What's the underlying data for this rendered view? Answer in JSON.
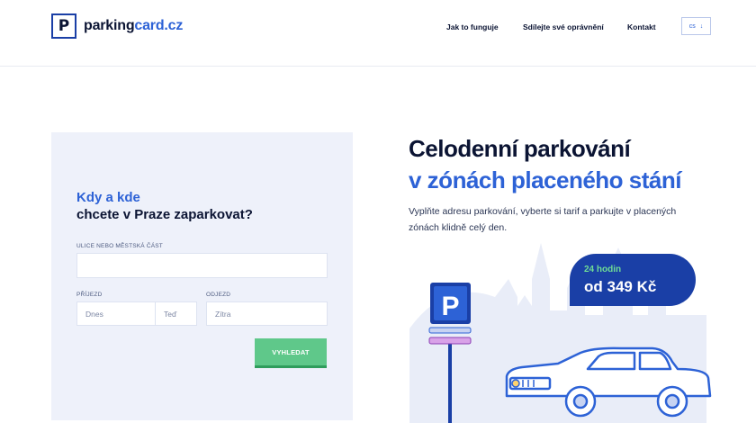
{
  "header": {
    "logo": {
      "letter": "P",
      "text_part1": "parking",
      "text_part2": "card.cz"
    },
    "nav": [
      "Jak to funguje",
      "Sdílejte své oprávnění",
      "Kontakt"
    ],
    "language": {
      "value": "cs",
      "arrow": "↓"
    }
  },
  "form": {
    "title_line1": "Kdy a kde",
    "title_line2": "chcete v Praze zaparkovat?",
    "street_label": "ULICE NEBO MĚSTSKÁ ČÁST",
    "street_value": "",
    "arrival_label": "PŘÍJEZD",
    "arrival_date": "Dnes",
    "arrival_time": "Teď",
    "departure_label": "ODJEZD",
    "departure_date": "Zítra",
    "search_button": "VYHLEDAT"
  },
  "hero": {
    "title_line1": "Celodenní parkování",
    "title_line2": "v zónách placeného stání",
    "description": "Vyplňte adresu parkování, vyberte si tarif a parkujte v placených zónách klidně celý den."
  },
  "badge": {
    "line1": "24 hodin",
    "line2": "od 349 Kč"
  },
  "sign": {
    "letter": "P"
  },
  "colors": {
    "brand_blue": "#1a3fa6",
    "accent_blue": "#2d62d6",
    "green": "#5fc88a",
    "panel_bg": "#eef1fa"
  }
}
